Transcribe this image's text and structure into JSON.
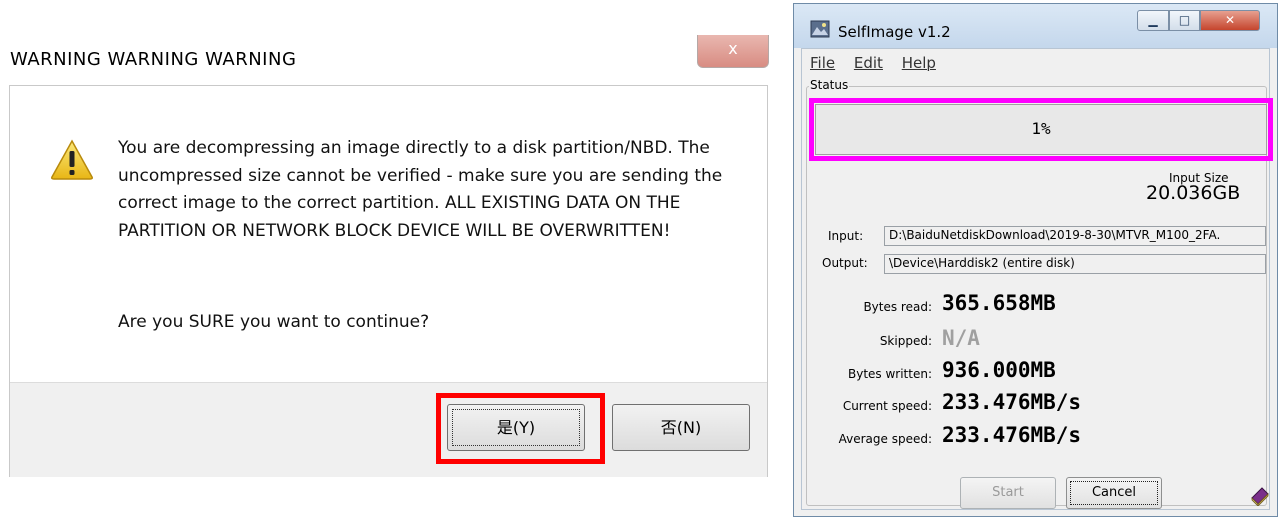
{
  "warning_dialog": {
    "title": "WARNING WARNING WARNING",
    "close_glyph": "x",
    "message": "You are decompressing an image directly to a disk partition/NBD.  The uncompressed size cannot be verified - make sure you are sending the correct image to the correct partition.  ALL EXISTING DATA ON THE PARTITION OR NETWORK BLOCK DEVICE WILL BE OVERWRITTEN!",
    "question": "Are you SURE you want to continue?",
    "yes_label": "是(Y)",
    "no_label": "否(N)",
    "icon": "warning-triangle-icon"
  },
  "selfimage": {
    "title": "SelfImage v1.2",
    "menu": [
      "File",
      "Edit",
      "Help"
    ],
    "status_label": "Status",
    "progress_text": "1%",
    "progress_fraction": 0.01,
    "input_size_label": "Input Size",
    "input_size_value": "20.036GB",
    "input_label": "Input:",
    "input_value": "D:\\BaiduNetdiskDownload\\2019-8-30\\MTVR_M100_2FA.",
    "output_label": "Output:",
    "output_value": "\\Device\\Harddisk2 (entire disk)",
    "stats": [
      {
        "label": "Bytes read:",
        "value": "365.658MB",
        "dim": false
      },
      {
        "label": "Skipped:",
        "value": "N/A",
        "dim": true
      },
      {
        "label": "Bytes written:",
        "value": "936.000MB",
        "dim": false
      },
      {
        "label": "Current speed:",
        "value": "233.476MB/s",
        "dim": false
      },
      {
        "label": "Average speed:",
        "value": "233.476MB/s",
        "dim": false
      }
    ],
    "start_label": "Start",
    "cancel_label": "Cancel",
    "colors": {
      "highlight_progress": "#ff00ff",
      "highlight_yes": "#ff0000"
    }
  }
}
